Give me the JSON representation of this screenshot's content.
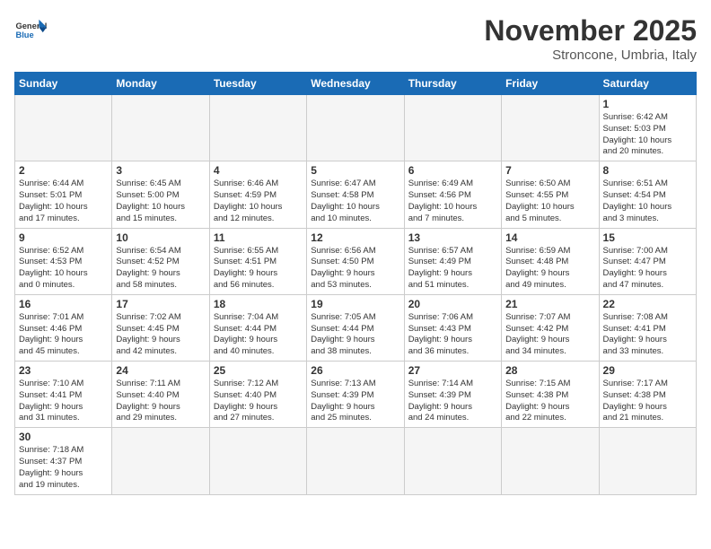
{
  "logo": {
    "text_general": "General",
    "text_blue": "Blue"
  },
  "title": "November 2025",
  "subtitle": "Stroncone, Umbria, Italy",
  "weekdays": [
    "Sunday",
    "Monday",
    "Tuesday",
    "Wednesday",
    "Thursday",
    "Friday",
    "Saturday"
  ],
  "weeks": [
    [
      {
        "day": "",
        "info": ""
      },
      {
        "day": "",
        "info": ""
      },
      {
        "day": "",
        "info": ""
      },
      {
        "day": "",
        "info": ""
      },
      {
        "day": "",
        "info": ""
      },
      {
        "day": "",
        "info": ""
      },
      {
        "day": "1",
        "info": "Sunrise: 6:42 AM\nSunset: 5:03 PM\nDaylight: 10 hours\nand 20 minutes."
      }
    ],
    [
      {
        "day": "2",
        "info": "Sunrise: 6:44 AM\nSunset: 5:01 PM\nDaylight: 10 hours\nand 17 minutes."
      },
      {
        "day": "3",
        "info": "Sunrise: 6:45 AM\nSunset: 5:00 PM\nDaylight: 10 hours\nand 15 minutes."
      },
      {
        "day": "4",
        "info": "Sunrise: 6:46 AM\nSunset: 4:59 PM\nDaylight: 10 hours\nand 12 minutes."
      },
      {
        "day": "5",
        "info": "Sunrise: 6:47 AM\nSunset: 4:58 PM\nDaylight: 10 hours\nand 10 minutes."
      },
      {
        "day": "6",
        "info": "Sunrise: 6:49 AM\nSunset: 4:56 PM\nDaylight: 10 hours\nand 7 minutes."
      },
      {
        "day": "7",
        "info": "Sunrise: 6:50 AM\nSunset: 4:55 PM\nDaylight: 10 hours\nand 5 minutes."
      },
      {
        "day": "8",
        "info": "Sunrise: 6:51 AM\nSunset: 4:54 PM\nDaylight: 10 hours\nand 3 minutes."
      }
    ],
    [
      {
        "day": "9",
        "info": "Sunrise: 6:52 AM\nSunset: 4:53 PM\nDaylight: 10 hours\nand 0 minutes."
      },
      {
        "day": "10",
        "info": "Sunrise: 6:54 AM\nSunset: 4:52 PM\nDaylight: 9 hours\nand 58 minutes."
      },
      {
        "day": "11",
        "info": "Sunrise: 6:55 AM\nSunset: 4:51 PM\nDaylight: 9 hours\nand 56 minutes."
      },
      {
        "day": "12",
        "info": "Sunrise: 6:56 AM\nSunset: 4:50 PM\nDaylight: 9 hours\nand 53 minutes."
      },
      {
        "day": "13",
        "info": "Sunrise: 6:57 AM\nSunset: 4:49 PM\nDaylight: 9 hours\nand 51 minutes."
      },
      {
        "day": "14",
        "info": "Sunrise: 6:59 AM\nSunset: 4:48 PM\nDaylight: 9 hours\nand 49 minutes."
      },
      {
        "day": "15",
        "info": "Sunrise: 7:00 AM\nSunset: 4:47 PM\nDaylight: 9 hours\nand 47 minutes."
      }
    ],
    [
      {
        "day": "16",
        "info": "Sunrise: 7:01 AM\nSunset: 4:46 PM\nDaylight: 9 hours\nand 45 minutes."
      },
      {
        "day": "17",
        "info": "Sunrise: 7:02 AM\nSunset: 4:45 PM\nDaylight: 9 hours\nand 42 minutes."
      },
      {
        "day": "18",
        "info": "Sunrise: 7:04 AM\nSunset: 4:44 PM\nDaylight: 9 hours\nand 40 minutes."
      },
      {
        "day": "19",
        "info": "Sunrise: 7:05 AM\nSunset: 4:44 PM\nDaylight: 9 hours\nand 38 minutes."
      },
      {
        "day": "20",
        "info": "Sunrise: 7:06 AM\nSunset: 4:43 PM\nDaylight: 9 hours\nand 36 minutes."
      },
      {
        "day": "21",
        "info": "Sunrise: 7:07 AM\nSunset: 4:42 PM\nDaylight: 9 hours\nand 34 minutes."
      },
      {
        "day": "22",
        "info": "Sunrise: 7:08 AM\nSunset: 4:41 PM\nDaylight: 9 hours\nand 33 minutes."
      }
    ],
    [
      {
        "day": "23",
        "info": "Sunrise: 7:10 AM\nSunset: 4:41 PM\nDaylight: 9 hours\nand 31 minutes."
      },
      {
        "day": "24",
        "info": "Sunrise: 7:11 AM\nSunset: 4:40 PM\nDaylight: 9 hours\nand 29 minutes."
      },
      {
        "day": "25",
        "info": "Sunrise: 7:12 AM\nSunset: 4:40 PM\nDaylight: 9 hours\nand 27 minutes."
      },
      {
        "day": "26",
        "info": "Sunrise: 7:13 AM\nSunset: 4:39 PM\nDaylight: 9 hours\nand 25 minutes."
      },
      {
        "day": "27",
        "info": "Sunrise: 7:14 AM\nSunset: 4:39 PM\nDaylight: 9 hours\nand 24 minutes."
      },
      {
        "day": "28",
        "info": "Sunrise: 7:15 AM\nSunset: 4:38 PM\nDaylight: 9 hours\nand 22 minutes."
      },
      {
        "day": "29",
        "info": "Sunrise: 7:17 AM\nSunset: 4:38 PM\nDaylight: 9 hours\nand 21 minutes."
      }
    ],
    [
      {
        "day": "30",
        "info": "Sunrise: 7:18 AM\nSunset: 4:37 PM\nDaylight: 9 hours\nand 19 minutes."
      },
      {
        "day": "",
        "info": ""
      },
      {
        "day": "",
        "info": ""
      },
      {
        "day": "",
        "info": ""
      },
      {
        "day": "",
        "info": ""
      },
      {
        "day": "",
        "info": ""
      },
      {
        "day": "",
        "info": ""
      }
    ]
  ]
}
